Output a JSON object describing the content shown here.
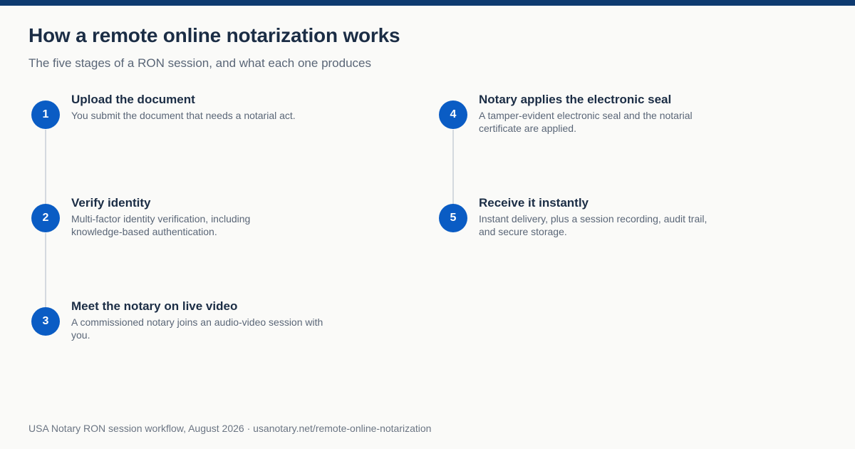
{
  "header": {
    "title": "How a remote online notarization works",
    "subtitle": "The five stages of a RON session, and what each one produces"
  },
  "steps": [
    {
      "number": "1",
      "title": "Upload the document",
      "description": "You submit the document that needs a notarial act."
    },
    {
      "number": "2",
      "title": "Verify identity",
      "description": "Multi-factor identity verification, including knowledge-based authentication."
    },
    {
      "number": "3",
      "title": "Meet the notary on live video",
      "description": "A commissioned notary joins an audio-video session with you."
    },
    {
      "number": "4",
      "title": "Notary applies the electronic seal",
      "description": "A tamper-evident electronic seal and the notarial certificate are applied."
    },
    {
      "number": "5",
      "title": "Receive it instantly",
      "description": "Instant delivery, plus a session recording, audit trail, and secure storage."
    }
  ],
  "footer": {
    "source": "USA Notary RON session workflow, August 2026 · usanotary.net/remote-online-notarization"
  },
  "colors": {
    "accent": "#0a5cc4",
    "top_bar": "#0d3a70",
    "connector": "#d4d9df"
  }
}
